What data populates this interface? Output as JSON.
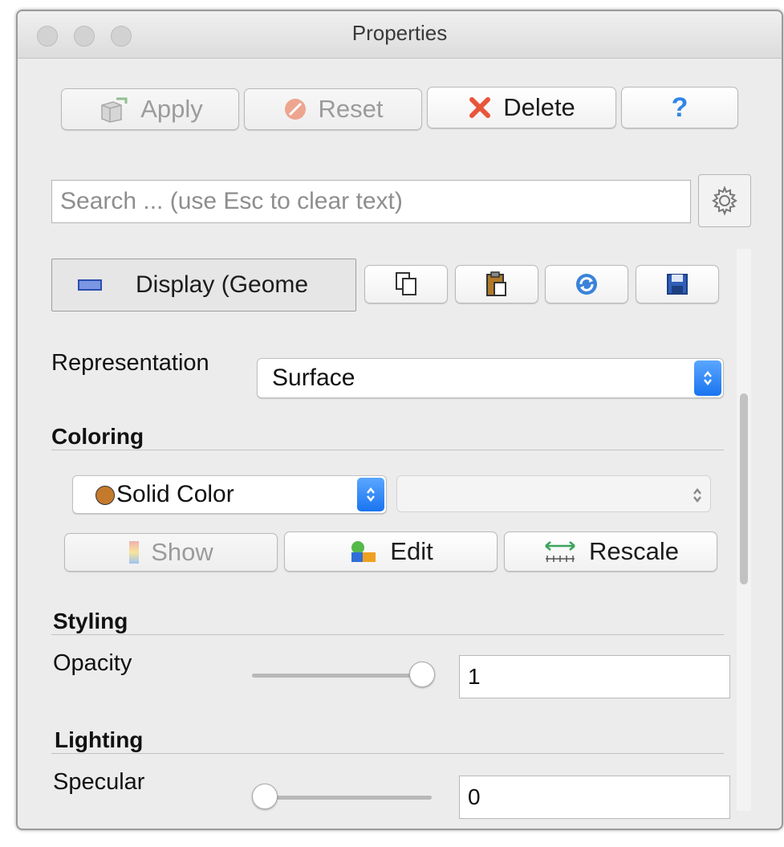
{
  "window": {
    "title": "Properties"
  },
  "toolbar": {
    "apply_label": "Apply",
    "reset_label": "Reset",
    "delete_label": "Delete",
    "help_label": "?"
  },
  "search": {
    "placeholder": "Search ... (use Esc to clear text)"
  },
  "display": {
    "section_label": "Display (Geome"
  },
  "representation": {
    "label": "Representation",
    "value": "Surface"
  },
  "coloring": {
    "heading": "Coloring",
    "color_mode": "Solid Color",
    "solid_color_hex": "#c47a2c",
    "array_value": "",
    "show_label": "Show",
    "edit_label": "Edit",
    "rescale_label": "Rescale"
  },
  "styling": {
    "heading": "Styling",
    "opacity_label": "Opacity",
    "opacity_value": "1",
    "opacity_fraction": 1.0
  },
  "lighting": {
    "heading": "Lighting",
    "specular_label": "Specular",
    "specular_value": "0",
    "specular_fraction": 0.0
  },
  "colors": {
    "accent_blue": "#1a74f0",
    "delete_red": "#e8553a",
    "help_blue": "#2f86e6"
  }
}
